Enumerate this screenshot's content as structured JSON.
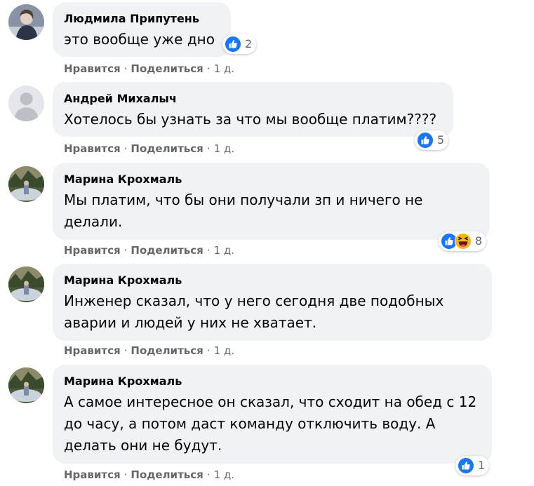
{
  "comments": [
    {
      "author": "Людмила Припутень",
      "text": "это вообще уже дно",
      "reactions": [
        "like"
      ],
      "reaction_count": "2",
      "like_label": "Нравится",
      "share_label": "Поделиться",
      "time": "1 д."
    },
    {
      "author": "Андрей Михалыч",
      "text": "Хотелось бы узнать за что мы вообще платим????",
      "reactions": [
        "like"
      ],
      "reaction_count": "5",
      "like_label": "Нравится",
      "share_label": "Поделиться",
      "time": "1 д."
    },
    {
      "author": "Марина Крохмаль",
      "text": "Мы платим, что бы они получали зп и ничего не\nделали.",
      "reactions": [
        "like",
        "haha"
      ],
      "reaction_count": "8",
      "like_label": "Нравится",
      "share_label": "Поделиться",
      "time": "1 д."
    },
    {
      "author": "Марина Крохмаль",
      "text": "Инженер сказал, что у него сегодня две подобных\nаварии и людей у них не хватает.",
      "reactions": [],
      "reaction_count": "",
      "like_label": "Нравится",
      "share_label": "Поделиться",
      "time": "1 д."
    },
    {
      "author": "Марина Крохмаль",
      "text": "А самое интересное он сказал, что сходит на обед с 12\nдо часу, а потом даст команду отключить воду. А\nделать они не будут.",
      "reactions": [
        "like"
      ],
      "reaction_count": "1",
      "like_label": "Нравится",
      "share_label": "Поделиться",
      "time": "1 д."
    }
  ],
  "colors": {
    "bubble": "#f0f2f5",
    "meta": "#65676b",
    "like": "#1877f2",
    "haha": "#f7b125"
  },
  "icons": {
    "like": "like-reaction-icon",
    "haha": "haha-reaction-icon",
    "separator": "·"
  }
}
